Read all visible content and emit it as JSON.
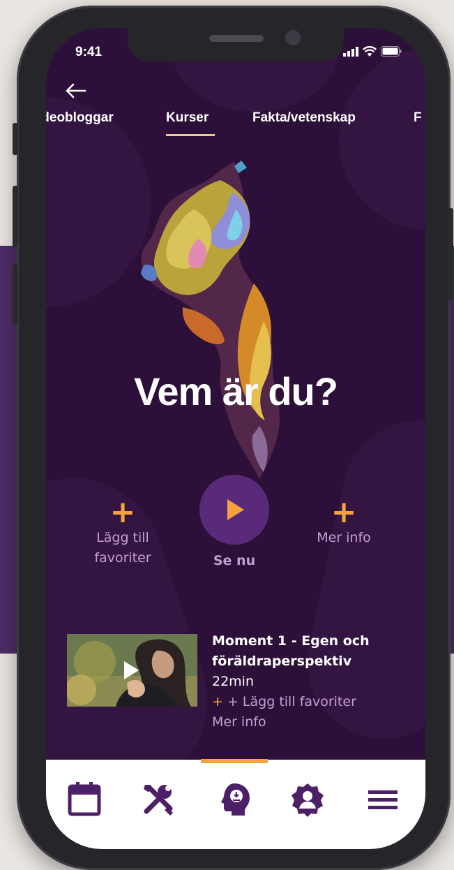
{
  "status": {
    "time": "9:41"
  },
  "tabs": [
    "ideobloggar",
    "Kurser",
    "Fakta/vetenskap",
    "F"
  ],
  "selected_tab": "Kurser",
  "hero": {
    "title": "Vem är du?"
  },
  "actions": {
    "add_favorite": "Lägg till\nfavoriter",
    "watch_now": "Se nu",
    "more_info": "Mer info"
  },
  "episode": {
    "title": "Moment 1 - Egen och föräldraperspektiv",
    "duration": "22min",
    "add_favorite": "+ Lägg till favoriter",
    "more_info": "Mer info"
  },
  "bottom_nav": [
    "calendar-icon",
    "tools-icon",
    "head-icon",
    "badge-icon",
    "menu-icon"
  ],
  "colors": {
    "accent": "#f6a23e",
    "screen_bg": "#2d1039",
    "band_bg": "#4f2c68",
    "nav_icon": "#4d1f66",
    "muted_text": "#c49fd4"
  }
}
